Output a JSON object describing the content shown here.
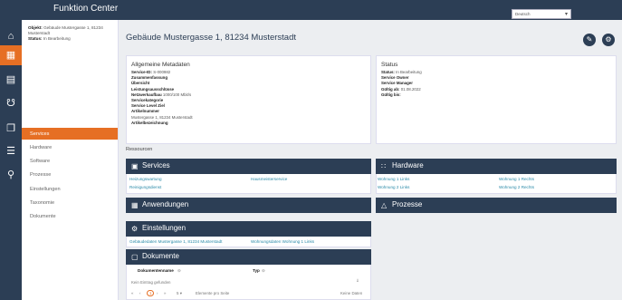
{
  "app": {
    "title": "Funktion Center"
  },
  "language": {
    "selected": "Deutsch"
  },
  "context": {
    "objekt_label": "Objekt:",
    "objekt_value": "Gebäude Mustergasse 1, 81234 Musterstadt",
    "status_label": "Status:",
    "status_value": "In Bearbeitung"
  },
  "subnav": [
    "Services",
    "Hardware",
    "Software",
    "Prozesse",
    "Einstellungen",
    "Taxonomie",
    "Dokumente"
  ],
  "page": {
    "title": "Gebäude Mustergasse 1, 81234 Musterstadt"
  },
  "meta": {
    "title": "Allgemeine Metadaten",
    "rows": [
      {
        "k": "Service-ID:",
        "v": "S-000982"
      },
      {
        "k": "Zusammenfassung",
        "v": ""
      },
      {
        "k": "Übersicht",
        "v": ""
      },
      {
        "k": "Leistungsausschlüsse",
        "v": ""
      },
      {
        "k": "Netzwerkaufbau",
        "v": "1000/100 Mbit/s"
      },
      {
        "k": "Servicekategorie",
        "v": ""
      },
      {
        "k": "Service Level Ziel",
        "v": ""
      },
      {
        "k": "Artikelnummer",
        "v": ""
      },
      {
        "k": "",
        "v": "Mustergasse 1, 81234 Musterstadt"
      },
      {
        "k": "Artikelbezeichnung",
        "v": ""
      }
    ]
  },
  "status": {
    "title": "Status",
    "rows": [
      {
        "k": "Status:",
        "v": "In Bearbeitung"
      },
      {
        "k": "Service Owner",
        "v": ""
      },
      {
        "k": "Service Manager",
        "v": ""
      },
      {
        "k": "Gültig ab:",
        "v": "01.08.2022"
      },
      {
        "k": "Gültig bis:",
        "v": ""
      }
    ]
  },
  "resources_label": "Ressourcen",
  "panels": {
    "services": {
      "title": "Services",
      "links": [
        "Heizungswartung",
        "Hausmeisterservice",
        "Reinigungsdienst"
      ]
    },
    "hardware": {
      "title": "Hardware",
      "links": [
        "Wohnung 1 Links",
        "Wohnung 1 Rechts",
        "Wohnung 2 Links",
        "Wohnung 2 Rechts"
      ]
    },
    "anwendungen": {
      "title": "Anwendungen"
    },
    "prozesse": {
      "title": "Prozesse"
    },
    "einstellungen": {
      "title": "Einstellungen",
      "links": [
        "Gebäudedaten Mustergasse 1, 81234 Musterstadt",
        "Wohnungsdaten Wohnung 1 Links"
      ]
    },
    "dokumente": {
      "title": "Dokumente",
      "col_name": "Dokumentenname",
      "col_type": "Typ",
      "empty": "Kein Eintrag gefunden",
      "page": "1",
      "per_page": "5",
      "per_page_label": "Elemente pro Seite",
      "no_data": "Keine Daten"
    }
  },
  "colors": {
    "nav": "#2c3e55",
    "accent": "#e66f24",
    "link": "#2a8aa8"
  }
}
